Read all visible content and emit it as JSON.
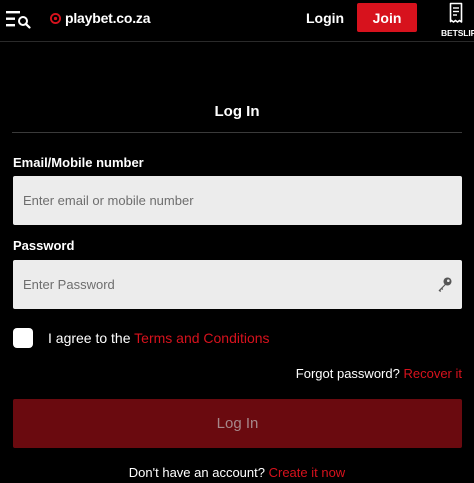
{
  "header": {
    "logo_text": "playbet.co.za",
    "login_label": "Login",
    "join_label": "Join",
    "betslip_label": "BETSLIP",
    "icons": [
      "menu-search-icon",
      "logo-mark-icon",
      "betslip-ticket-icon"
    ]
  },
  "form": {
    "title": "Log In",
    "email_label": "Email/Mobile number",
    "email_placeholder": "Enter email or mobile number",
    "email_value": "",
    "password_label": "Password",
    "password_placeholder": "Enter Password",
    "password_value": "",
    "agree_prefix": "I agree to the",
    "terms_link": "Terms and Conditions",
    "forgot_text": "Forgot password?",
    "recover_link": "Recover it",
    "submit_label": "Log In",
    "signup_text": "Don't have an account?",
    "create_link": "Create it now"
  },
  "colors": {
    "background": "#000000",
    "accent": "#d7121d",
    "submit_disabled": "#6a0a0f",
    "input_bg": "#ececec"
  }
}
